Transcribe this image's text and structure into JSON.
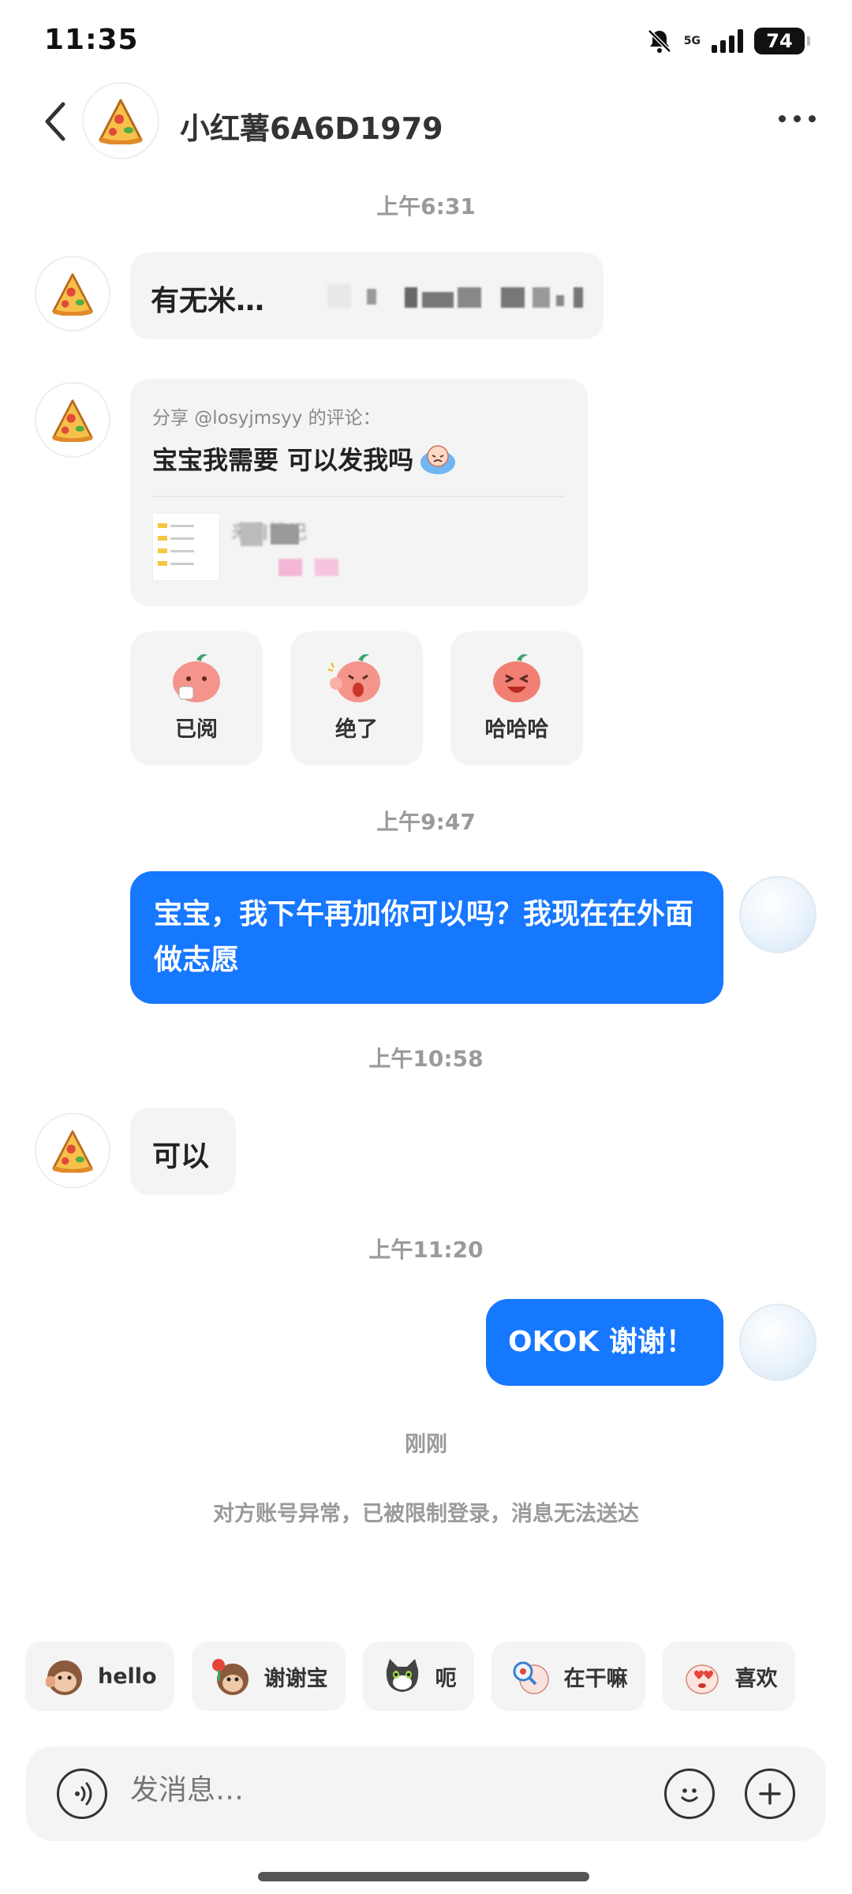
{
  "status_bar": {
    "time": "11:35",
    "network": "5G",
    "battery": "74",
    "icons": [
      "mute-bell-icon",
      "signal-icon",
      "battery-icon"
    ]
  },
  "header": {
    "title": "小红薯6A6D1979",
    "back_icon": "chevron-left-icon",
    "more_icon": "more-dots-icon",
    "avatar_icon": "pizza-icon"
  },
  "messages": {
    "t1": "上午6:31",
    "m1_text": "有无米…",
    "share": {
      "meta": "分享 @losyjmsyy 的评论：",
      "text": "宝宝我需要 可以发我吗",
      "source": "来自笔记"
    },
    "stickers": [
      "已阅",
      "绝了",
      "哈哈哈"
    ],
    "t2": "上午9:47",
    "m2_text": "宝宝，我下午再加你可以吗？我现在在外面做志愿",
    "t3": "上午10:58",
    "m3_text": "可以",
    "t4": "上午11:20",
    "m4_text": "OKOK 谢谢！",
    "t5": "刚刚",
    "system_note": "对方账号异常，已被限制登录，消息无法送达"
  },
  "quick_replies": [
    "hello",
    "谢谢宝",
    "呃",
    "在干嘛",
    "喜欢"
  ],
  "input": {
    "placeholder": "发消息…",
    "voice_icon": "voice-icon",
    "emoji_icon": "emoji-icon",
    "plus_icon": "plus-icon"
  },
  "colors": {
    "accent": "#1677ff",
    "bubble_in": "#f4f4f4",
    "muted_text": "#9a9a9a"
  }
}
